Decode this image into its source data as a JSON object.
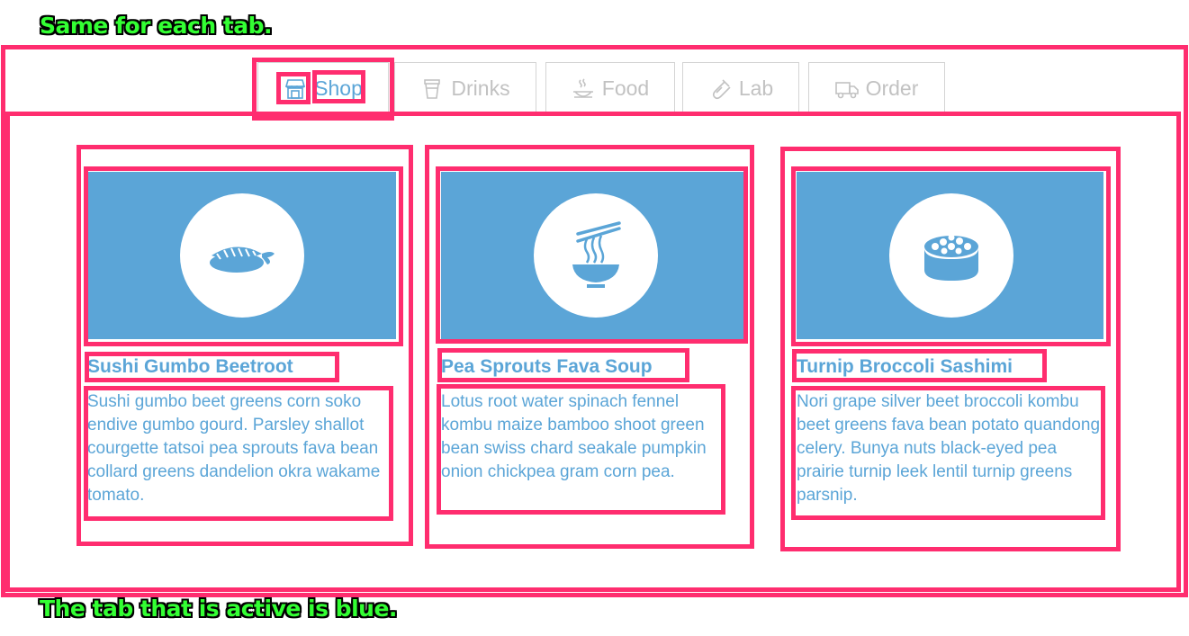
{
  "annotations": {
    "top": "Same for each tab.",
    "bottom": "The tab that is active is blue."
  },
  "tabs": [
    {
      "label": "Shop",
      "icon": "shop-icon",
      "active": true
    },
    {
      "label": "Drinks",
      "icon": "cup-icon",
      "active": false
    },
    {
      "label": "Food",
      "icon": "dish-icon",
      "active": false
    },
    {
      "label": "Lab",
      "icon": "flask-icon",
      "active": false
    },
    {
      "label": "Order",
      "icon": "truck-icon",
      "active": false
    }
  ],
  "cards": [
    {
      "title": "Sushi Gumbo Beetroot",
      "description": "Sushi gumbo beet greens corn soko endive gumbo gourd. Parsley shallot courgette tatsoi pea sprouts fava bean collard greens dandelion okra wakame tomato.",
      "icon": "shrimp-nigiri-icon"
    },
    {
      "title": "Pea Sprouts Fava Soup",
      "description": "Lotus root water spinach fennel kombu maize bamboo shoot green bean swiss chard seakale pumpkin onion chickpea gram corn pea.",
      "icon": "noodle-bowl-icon"
    },
    {
      "title": "Turnip Broccoli Sashimi",
      "description": "Nori grape silver beet broccoli kombu beet greens fava bean potato quandong celery. Bunya nuts black-eyed pea prairie turnip leek lentil turnip greens parsnip.",
      "icon": "roe-sushi-icon"
    }
  ],
  "colors": {
    "accent": "#5ba5d7",
    "inactive_tab": "#c2c2c2",
    "annotation_box": "#ff2d6f",
    "annotation_text": "#33ff33"
  }
}
